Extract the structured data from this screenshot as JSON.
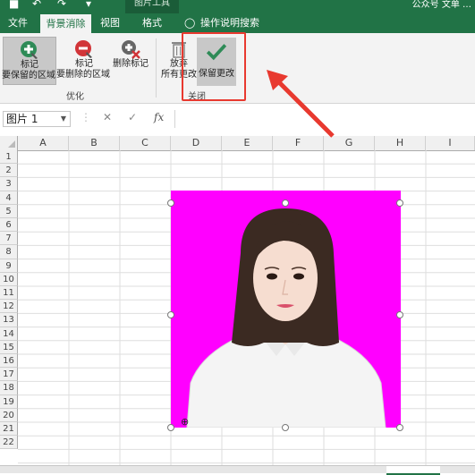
{
  "titlebar": {
    "context_tab": "图片工具",
    "account": "公众号 文单 …"
  },
  "tabs": [
    {
      "label": "文件"
    },
    {
      "label": "背景消除"
    },
    {
      "label": "视图"
    },
    {
      "label": "格式"
    },
    {
      "label": "操作说明搜索"
    }
  ],
  "ribbon": {
    "mark_keep_line1": "标记",
    "mark_keep_line2": "要保留的区域",
    "mark_remove_line1": "标记",
    "mark_remove_line2": "要删除的区域",
    "delete_mark": "删除标记",
    "group_optimize": "优化",
    "discard_line1": "放弃",
    "discard_line2": "所有更改",
    "keep_changes": "保留更改",
    "group_close": "关闭"
  },
  "formula_bar": {
    "name_box": "图片 1",
    "cancel_symbol": "✕",
    "enter_symbol": "✓",
    "fx_symbol": "fx",
    "formula_value": ""
  },
  "columns": [
    "A",
    "B",
    "C",
    "D",
    "E",
    "F",
    "G",
    "H",
    "I"
  ],
  "rows": [
    "1",
    "2",
    "3",
    "4",
    "5",
    "6",
    "7",
    "8",
    "9",
    "10",
    "11",
    "12",
    "13",
    "14",
    "15",
    "16",
    "17",
    "18",
    "19",
    "20",
    "21",
    "22"
  ],
  "colors": {
    "excel_green": "#217346",
    "photo_background": "#ff00ff",
    "annotation_red": "#e8392f"
  }
}
